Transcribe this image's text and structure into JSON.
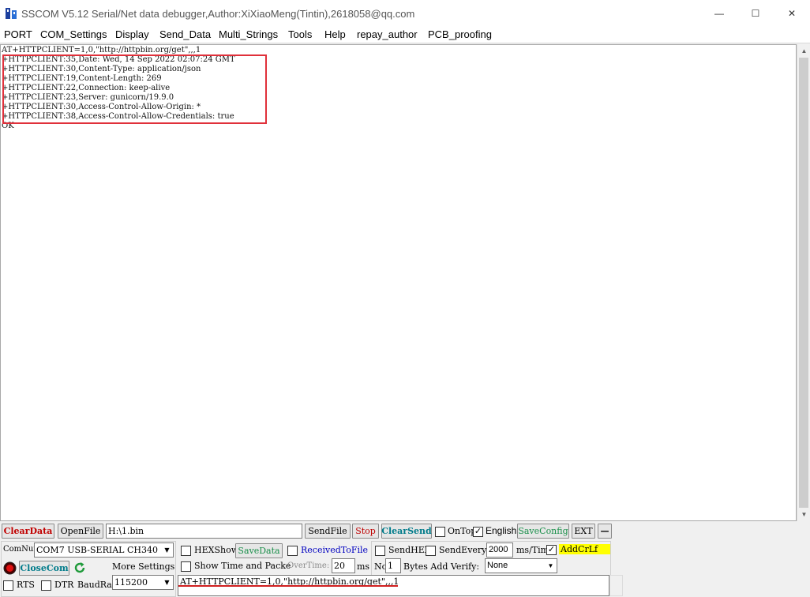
{
  "window": {
    "title": "SSCOM V5.12 Serial/Net data debugger,Author:XiXiaoMeng(Tintin),2618058@qq.com",
    "icon": "sscom-app-icon",
    "minimize_glyph": "—",
    "maximize_glyph": "☐",
    "close_glyph": "✕"
  },
  "menu": [
    "PORT",
    "COM_Settings",
    "Display",
    "Send_Data",
    "Multi_Strings",
    "Tools",
    "Help",
    "repay_author",
    "PCB_proofing"
  ],
  "receive": {
    "lines": [
      "AT+HTTPCLIENT=1,0,\"http://httpbin.org/get\",,,1",
      "+HTTPCLIENT:35,Date: Wed, 14 Sep 2022 02:07:24 GMT",
      "+HTTPCLIENT:30,Content-Type: application/json",
      "+HTTPCLIENT:19,Content-Length: 269",
      "+HTTPCLIENT:22,Connection: keep-alive",
      "+HTTPCLIENT:23,Server: gunicorn/19.9.0",
      "+HTTPCLIENT:30,Access-Control-Allow-Origin: *",
      "+HTTPCLIENT:38,Access-Control-Allow-Credentials: true",
      "OK"
    ],
    "highlight_color": "#e0303a"
  },
  "toolbar": {
    "clear_data": "ClearData",
    "open_file": "OpenFile",
    "file_path": "H:\\1.bin",
    "send_file": "SendFile",
    "stop": "Stop",
    "clear_send": "ClearSend",
    "on_top": "OnTop",
    "english": "English",
    "save_config": "SaveConfig",
    "ext": "EXT",
    "collapse": "—"
  },
  "port": {
    "com_num_label": "ComNum",
    "com_port": "COM7 USB-SERIAL CH340",
    "close_com": "CloseCom",
    "more_settings": "More Settings",
    "rts": "RTS",
    "dtr": "DTR",
    "baud_label": "BaudRat",
    "baud_rate": "115200"
  },
  "display": {
    "hex_show": "HEXShow",
    "save_data": "SaveData",
    "received_to_file": "ReceivedToFile",
    "show_time": "Show Time and Packe",
    "overtime_label": "OverTime:",
    "overtime_value": "20",
    "ms": "ms"
  },
  "send_opts": {
    "send_hex": "SendHEX",
    "send_every": "SendEvery:",
    "interval": "2000",
    "interval_unit": "ms/Tim",
    "add_crlf": "AddCrLf",
    "no_label": "No",
    "bytes_value": "1",
    "verify_label": "Bytes Add Verify:",
    "verify": "None"
  },
  "send_text": "AT+HTTPCLIENT=1,0,\"http://httpbin.org/get\",,,1",
  "colors": {
    "accent_red": "#c00000",
    "crlf_highlight": "#ffff00",
    "box_red": "#e0303a"
  }
}
